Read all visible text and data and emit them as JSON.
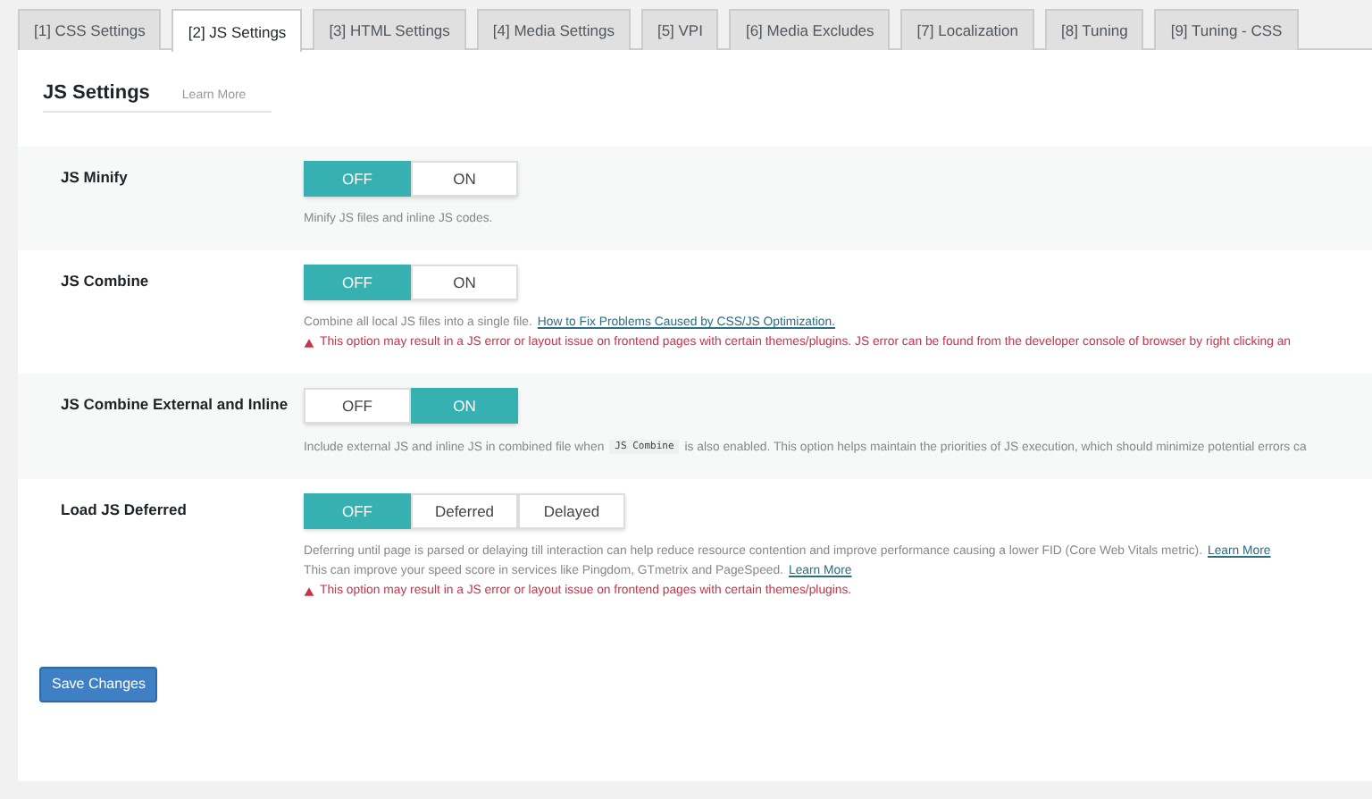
{
  "tabs": [
    {
      "label": "[1] CSS Settings",
      "selected": false
    },
    {
      "label": "[2] JS Settings",
      "selected": true
    },
    {
      "label": "[3] HTML Settings",
      "selected": false
    },
    {
      "label": "[4] Media Settings",
      "selected": false
    },
    {
      "label": "[5] VPI",
      "selected": false
    },
    {
      "label": "[6] Media Excludes",
      "selected": false
    },
    {
      "label": "[7] Localization",
      "selected": false
    },
    {
      "label": "[8] Tuning",
      "selected": false
    },
    {
      "label": "[9] Tuning - CSS",
      "selected": false
    }
  ],
  "section": {
    "title": "JS Settings",
    "link": "Learn More"
  },
  "settings": [
    {
      "label": "JS Minify",
      "options": [
        {
          "label": "OFF",
          "selected": true
        },
        {
          "label": "ON",
          "selected": false
        }
      ],
      "lines": [
        {
          "kind": "note",
          "parts": [
            {
              "kind": "text",
              "text": "Minify JS files and inline JS codes."
            }
          ]
        }
      ]
    },
    {
      "label": "JS Combine",
      "options": [
        {
          "label": "OFF",
          "selected": true
        },
        {
          "label": "ON",
          "selected": false
        }
      ],
      "lines": [
        {
          "kind": "note",
          "parts": [
            {
              "kind": "text",
              "text": "Combine all local JS files into a single file."
            },
            {
              "kind": "link",
              "text": "How to Fix Problems Caused by CSS/JS Optimization."
            }
          ]
        },
        {
          "kind": "warning",
          "parts": [
            {
              "kind": "text",
              "text": "This option may result in a JS error or layout issue on frontend pages with certain themes/plugins. JS error can be found from the developer console of browser by right clicking an"
            }
          ]
        }
      ]
    },
    {
      "label": "JS Combine External and Inline",
      "options": [
        {
          "label": "OFF",
          "selected": false
        },
        {
          "label": "ON",
          "selected": true
        }
      ],
      "lines": [
        {
          "kind": "note",
          "parts": [
            {
              "kind": "text",
              "text": "Include external JS and inline JS in combined file when"
            },
            {
              "kind": "code",
              "text": "JS Combine"
            },
            {
              "kind": "text",
              "text": "is also enabled. This option helps maintain the priorities of JS execution, which should minimize potential errors ca"
            }
          ]
        }
      ]
    },
    {
      "label": "Load JS Deferred",
      "options": [
        {
          "label": "OFF",
          "selected": true
        },
        {
          "label": "Deferred",
          "selected": false
        },
        {
          "label": "Delayed",
          "selected": false
        }
      ],
      "lines": [
        {
          "kind": "note",
          "parts": [
            {
              "kind": "text",
              "text": "Deferring until page is parsed or delaying till interaction can help reduce resource contention and improve performance causing a lower FID (Core Web Vitals metric)."
            },
            {
              "kind": "link",
              "text": "Learn More"
            }
          ]
        },
        {
          "kind": "note",
          "parts": [
            {
              "kind": "text",
              "text": "This can improve your speed score in services like Pingdom, GTmetrix and PageSpeed."
            },
            {
              "kind": "link",
              "text": "Learn More"
            }
          ]
        },
        {
          "kind": "warning",
          "parts": [
            {
              "kind": "text",
              "text": "This option may result in a JS error or layout issue on frontend pages with certain themes/plugins."
            }
          ]
        }
      ]
    }
  ],
  "save_button": "Save Changes"
}
